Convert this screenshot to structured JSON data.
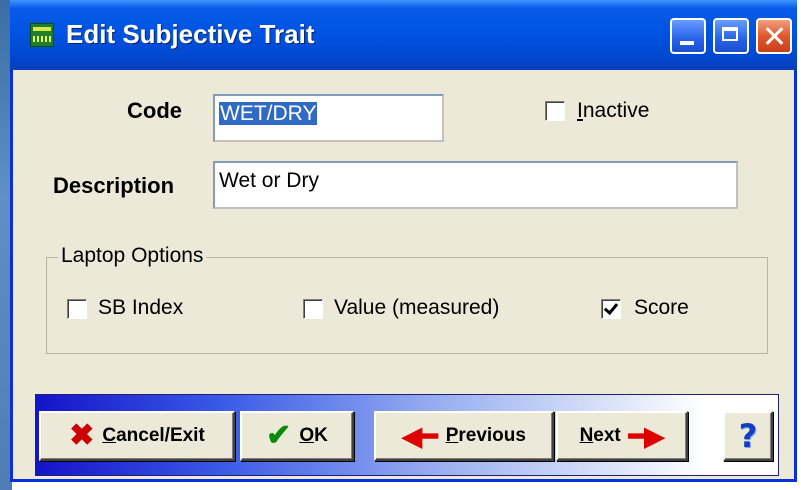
{
  "window": {
    "title": "Edit Subjective Trait"
  },
  "form": {
    "code_label": "Code",
    "code_value": "WET/DRY",
    "inactive_label_key": "I",
    "inactive_label_rest": "nactive",
    "inactive_checked": false,
    "description_label": "Description",
    "description_value": "Wet or Dry"
  },
  "laptop_options": {
    "legend": "Laptop Options",
    "sb_index_label": "SB Index",
    "sb_index_checked": false,
    "value_measured_label": "Value (measured)",
    "value_measured_checked": false,
    "score_label": "Score",
    "score_checked": true
  },
  "buttons": {
    "cancel_key": "C",
    "cancel_rest": "ancel/Exit",
    "ok_key": "O",
    "ok_rest": "K",
    "previous_key": "P",
    "previous_rest": "revious",
    "next_key": "N",
    "next_rest": "ext",
    "help_glyph": "?"
  },
  "icons": {
    "cancel": "x-icon",
    "ok": "checkmark-icon",
    "previous": "arrow-left-icon",
    "next": "arrow-right-icon",
    "help": "help-icon"
  },
  "colors": {
    "titlebar": "#0054e3",
    "selection": "#316ac5",
    "cancel_icon": "#cc0000",
    "ok_icon": "#0a8a0a",
    "arrows": "#dd0000"
  }
}
